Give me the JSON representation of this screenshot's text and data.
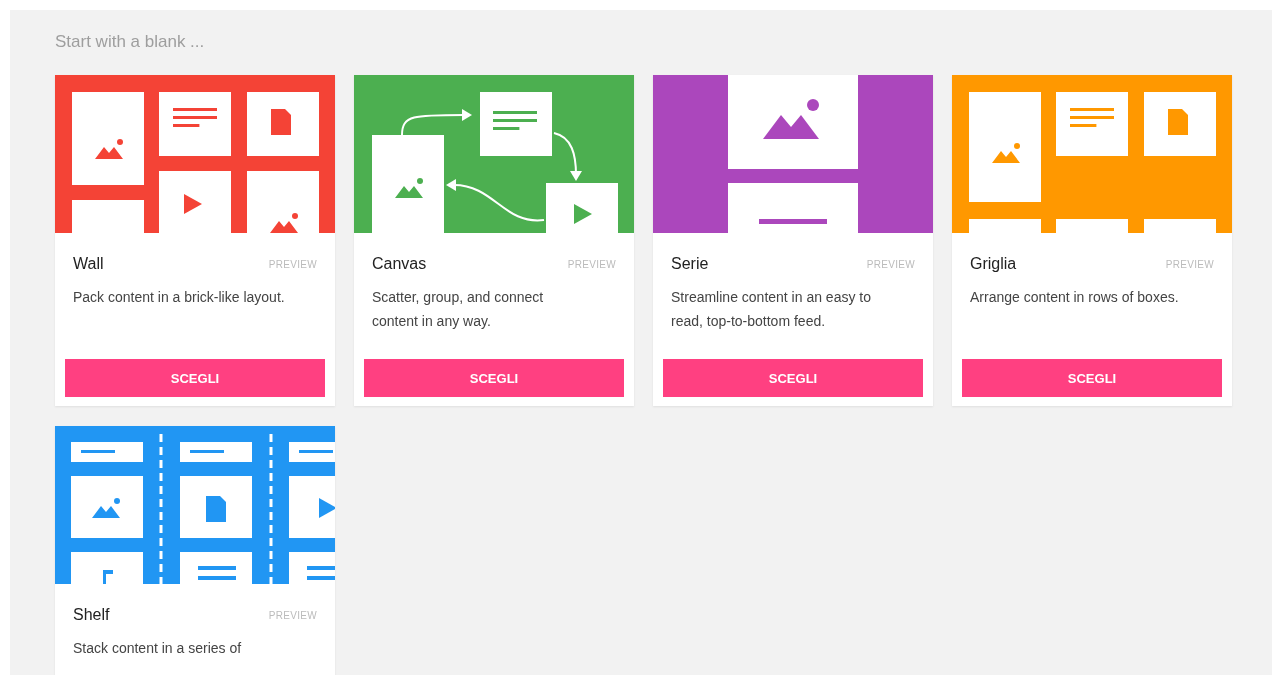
{
  "heading": "Start with a blank ...",
  "cards": [
    {
      "kind": "wall",
      "color": "#f44336",
      "title": "Wall",
      "badge": "PREVIEW",
      "description": "Pack content in a brick-like layout.",
      "button": "SCEGLI"
    },
    {
      "kind": "canvas",
      "color": "#4caf50",
      "title": "Canvas",
      "badge": "PREVIEW",
      "description": "Scatter, group, and connect content in any way.",
      "button": "SCEGLI"
    },
    {
      "kind": "serie",
      "color": "#ab47bc",
      "title": "Serie",
      "badge": "PREVIEW",
      "description": "Streamline content in an easy to read, top-to-bottom feed.",
      "button": "SCEGLI"
    },
    {
      "kind": "griglia",
      "color": "#ff9800",
      "title": "Griglia",
      "badge": "PREVIEW",
      "description": "Arrange content in rows of boxes.",
      "button": "SCEGLI"
    },
    {
      "kind": "shelf",
      "color": "#2196f3",
      "title": "Shelf",
      "badge": "PREVIEW",
      "description": "Stack content in a series of"
    }
  ]
}
